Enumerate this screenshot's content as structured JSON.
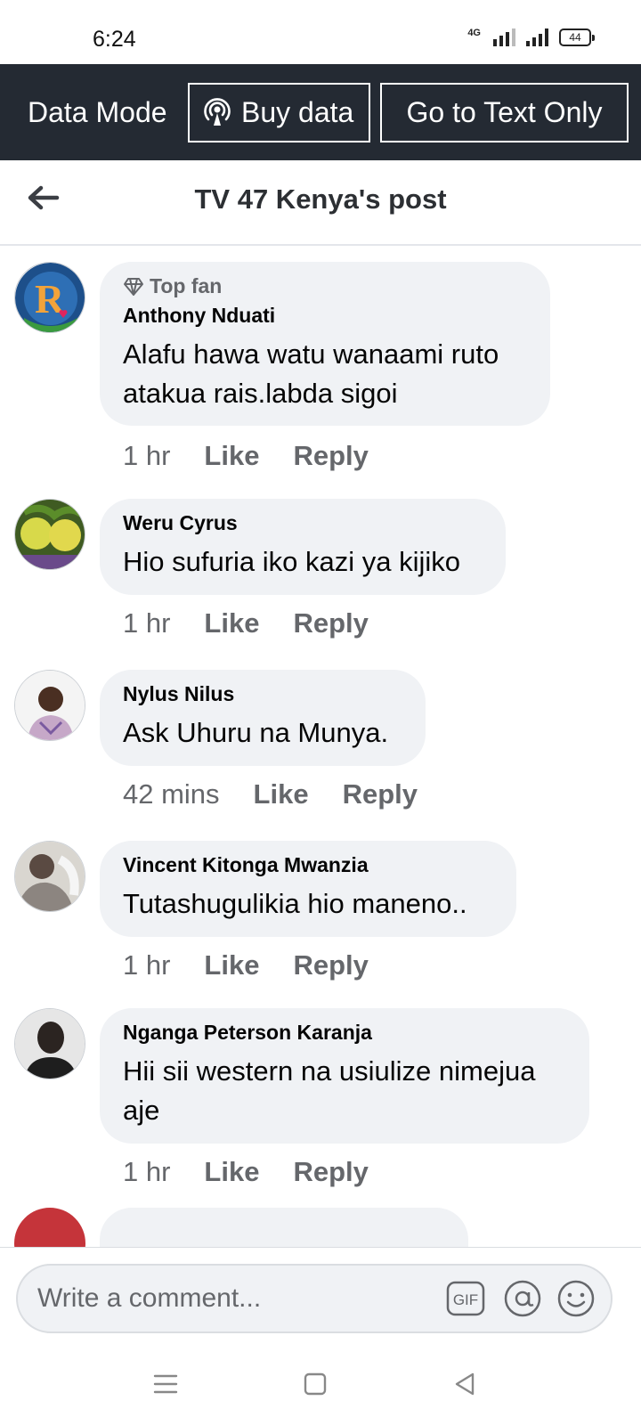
{
  "status": {
    "time": "6:24",
    "network": "4G",
    "battery": "44"
  },
  "data_mode": {
    "label": "Data Mode",
    "buy_label": "Buy data",
    "text_only_label": "Go to Text Only"
  },
  "header": {
    "title": "TV 47 Kenya's post"
  },
  "comments": [
    {
      "badge": "Top fan",
      "author": "Anthony Nduati",
      "text": "Alafu hawa watu wanaami ruto atakua rais.labda sigoi",
      "time": "1 hr",
      "like": "Like",
      "reply": "Reply"
    },
    {
      "author": "Weru Cyrus",
      "text": "Hio sufuria iko kazi ya kijiko",
      "time": "1 hr",
      "like": "Like",
      "reply": "Reply"
    },
    {
      "author": "Nylus Nilus",
      "text": "Ask Uhuru na Munya.",
      "time": "42 mins",
      "like": "Like",
      "reply": "Reply"
    },
    {
      "author": "Vincent Kitonga Mwanzia",
      "text": "Tutashugulikia hio maneno..",
      "time": "1 hr",
      "like": "Like",
      "reply": "Reply"
    },
    {
      "author": "Nganga Peterson Karanja",
      "text": "Hii sii western na usiulize nimejua aje",
      "time": "1 hr",
      "like": "Like",
      "reply": "Reply"
    }
  ],
  "composer": {
    "placeholder": "Write a comment..."
  },
  "icons": {
    "back": "arrow-left-icon",
    "buy": "broadcast-icon",
    "gif": "gif-icon",
    "mention": "at-sign-icon",
    "emoji": "smiley-icon"
  }
}
